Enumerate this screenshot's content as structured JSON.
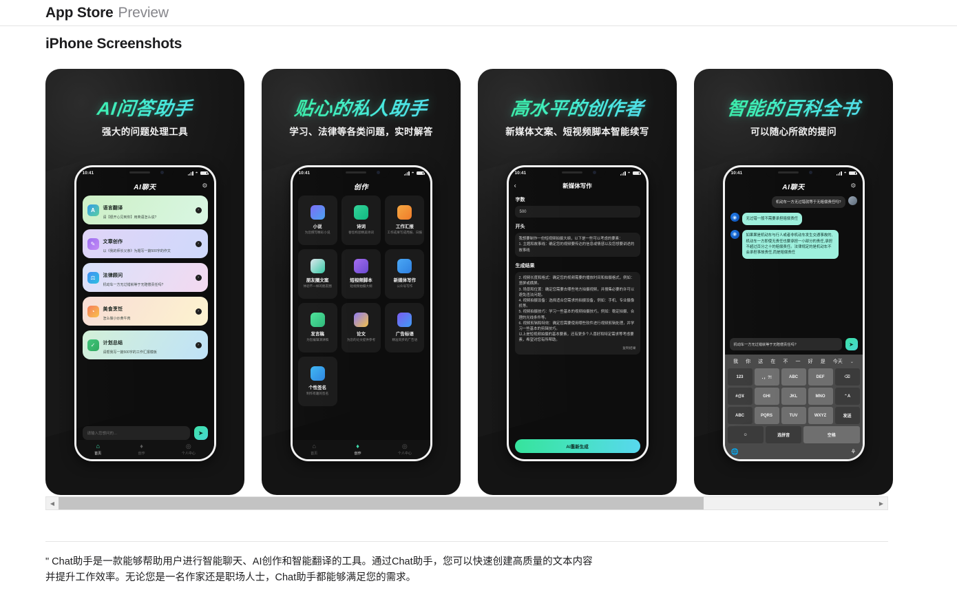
{
  "header": {
    "title": "App Store",
    "subtitle": "Preview"
  },
  "section": {
    "title": "iPhone Screenshots"
  },
  "status": {
    "time": "10:41"
  },
  "scrollbar": {
    "left_arrow": "◀",
    "right_arrow": "▶"
  },
  "footer": {
    "description": "\" Chat助手是一款能够帮助用户进行智能聊天、AI创作和智能翻译的工具。通过Chat助手，您可以快速创建高质量的文本内容并提升工作效率。无论您是一名作家还是职场人士，Chat助手都能够满足您的需求。"
  },
  "shots": [
    {
      "title": "AI问答助手",
      "subtitle": "强大的问题处理工具",
      "nav_title": "AI聊天",
      "gear_icon": "⚙",
      "cards": [
        {
          "title": "语言翻译",
          "sub": "请【很开心见到你】用英语怎么说?",
          "icon": "A",
          "grad": "linear-gradient(120deg,#cdf0c6,#d9f6e3)",
          "icon_grad": "linear-gradient(135deg,#2f9ae8,#5ad0a0)"
        },
        {
          "title": "文章创作",
          "sub": "以《我的师长父亲》为题写一篇500字的作文",
          "icon": "✎",
          "grad": "linear-gradient(120deg,#e0d4f7,#cfd9fb)",
          "icon_grad": "linear-gradient(135deg,#9b6cf0,#c38af5)"
        },
        {
          "title": "法律顾问",
          "sub": "机动车一方无过错就等于无赔偿责任吗?",
          "icon": "⚖",
          "grad": "linear-gradient(120deg,#d9e2fb,#f3d9f0)",
          "icon_grad": "linear-gradient(135deg,#3f8df5,#2bc0e0)"
        },
        {
          "title": "美食烹饪",
          "sub": "怎么做小炒黄牛肉",
          "icon": "◔",
          "grad": "linear-gradient(120deg,#f8ddd6,#fdf3cf)",
          "icon_grad": "linear-gradient(135deg,#f57a5a,#f9c24a)"
        },
        {
          "title": "计划总结",
          "sub": "请帮我写一篇500字的工作汇报模板",
          "icon": "✓",
          "grad": "linear-gradient(120deg,#d3f0d8,#bfe2f8)",
          "icon_grad": "linear-gradient(135deg,#3fc47a,#2fa95f)"
        }
      ],
      "composer": {
        "placeholder": "请输入您想问的…",
        "send_icon": "➤"
      },
      "tabs": [
        {
          "label": "首页",
          "icon": "⌂",
          "active": true
        },
        {
          "label": "创作",
          "icon": "♦",
          "active": false
        },
        {
          "label": "个人中心",
          "icon": "◎",
          "active": false
        }
      ]
    },
    {
      "title": "贴心的私人助手",
      "subtitle": "学习、法律等各类问题，实时解答",
      "nav_title": "创作",
      "grid": [
        {
          "title": "小说",
          "sub": "为您撰写精彩小说",
          "grad": "linear-gradient(135deg,#7b6cf6,#4aa3f0)"
        },
        {
          "title": "诗词",
          "sub": "替您构思精美诗词",
          "grad": "linear-gradient(135deg,#34d399,#10b981)"
        },
        {
          "title": "工作汇报",
          "sub": "工作成果写成周报、日报",
          "grad": "linear-gradient(135deg,#f5a742,#f07c2a)"
        },
        {
          "title": "朋友圈文案",
          "sub": "体验不一样的朋友圈",
          "grad": "linear-gradient(135deg,#dfe7ee,#36c9a5)"
        },
        {
          "title": "短视频脚本",
          "sub": "短视频拍摄大纲",
          "grad": "linear-gradient(135deg,#a46cf0,#6a4bd0)"
        },
        {
          "title": "新媒体写作",
          "sub": "公众号写作",
          "grad": "linear-gradient(135deg,#4aa8f5,#2f7fe0)"
        },
        {
          "title": "发言稿",
          "sub": "为您编辑演讲稿",
          "grad": "linear-gradient(135deg,#4ee39a,#2fb97a)"
        },
        {
          "title": "论文",
          "sub": "为您的论文提供参考",
          "grad": "linear-gradient(135deg,#8f7cf5,#f2c04a)"
        },
        {
          "title": "广告标语",
          "sub": "精准同步的广告语",
          "grad": "linear-gradient(135deg,#7b5cf0,#3f9df5)"
        },
        {
          "title": "个性签名",
          "sub": "制作有趣的签名",
          "grad": "linear-gradient(135deg,#3fb7f5,#2f86e0)"
        }
      ],
      "tabs": [
        {
          "label": "首页",
          "icon": "⌂",
          "active": false
        },
        {
          "label": "创作",
          "icon": "♦",
          "active": true
        },
        {
          "label": "个人中心",
          "icon": "◎",
          "active": false
        }
      ]
    },
    {
      "title": "高水平的创作者",
      "subtitle": "新媒体文案、短视频脚本智能续写",
      "nav_title": "新媒体写作",
      "back_icon": "‹",
      "form": {
        "count_label": "字数",
        "count_value": "500",
        "start_label": "开头",
        "start_text": "我想要制作一份短视频拍摄大纲，以下是一些可以考虑的要素：\n1. 主题和故事线：确定您的视频要传达的信息或情感以及您想要讲述的故事线",
        "result_label": "生成结果",
        "result_text": "2. 视频长度和格式：确定您的视频需要的播放时间和拍摄格式，例如：竖屏或横屏。\n3. 场景和位置：确定您需要去哪些地方拍摄视频，并搜集必要的许可以避免违法问题。\n4. 视频拍摄设备：选择适合您需求的拍摄设备，例如：手机、专业摄像机等。\n5. 视频拍摄技巧：学习一些基本的视频拍摄技巧，例如：稳定拍摄、合理的光线条件等。\n6. 视频剪辑和特效：确定您需要使用哪些软件进行视频剪辑处理，并学习一些基本的剪辑技巧。\n以上是短视频拍摄的基本要素，还有更多个人喜好和特定需求等考虑要素，希望对您有所帮助。",
        "copy_label": "复制结果",
        "regen_label": "AI重新生成"
      }
    },
    {
      "title": "智能的百科全书",
      "subtitle": "可以随心所欲的提问",
      "nav_title": "AI聊天",
      "gear_icon": "⚙",
      "messages": [
        {
          "from": "user",
          "text": "机动车一方无过错就等于无赔偿责任吗?"
        },
        {
          "from": "ai",
          "text": "无过错一般不需要承担赔偿责任"
        },
        {
          "from": "ai",
          "text": "如果果是机动车与行人或者非机动车发生交通事故的,机动车一方即使无责任也要承担一小部分的责任,承担不超过百分之十的赔偿责任。法律规定的是机动车不会承担事故责任,而是赔偿责任"
        }
      ],
      "input": {
        "value": "机动车一方无过错就等于无赔偿责任吗?",
        "send_icon": "➤"
      },
      "keyboard": {
        "suggestions": [
          "我",
          "你",
          "这",
          "在",
          "不",
          "一",
          "好",
          "是",
          "今天"
        ],
        "chevron": "⌄",
        "rows": [
          [
            {
              "label": "123",
              "dark": true
            },
            {
              "label": "．，?!"
            },
            {
              "label": "ABC"
            },
            {
              "label": "DEF"
            },
            {
              "label": "⌫",
              "dark": true
            }
          ],
          [
            {
              "label": "#@¥",
              "dark": true
            },
            {
              "label": "GHI"
            },
            {
              "label": "JKL"
            },
            {
              "label": "MNO"
            },
            {
              "label": "⌃A",
              "dark": true
            }
          ],
          [
            {
              "label": "ABC",
              "dark": true
            },
            {
              "label": "PQRS"
            },
            {
              "label": "TUV"
            },
            {
              "label": "WXYZ"
            },
            {
              "label": "发送",
              "dark": true
            }
          ],
          [
            {
              "label": "☺",
              "dark": true
            },
            {
              "label": "选拼音",
              "dark": true
            },
            {
              "label": "空格",
              "wide": true
            }
          ]
        ],
        "globe_icon": "🌐",
        "mic_icon": "⚘"
      }
    }
  ]
}
